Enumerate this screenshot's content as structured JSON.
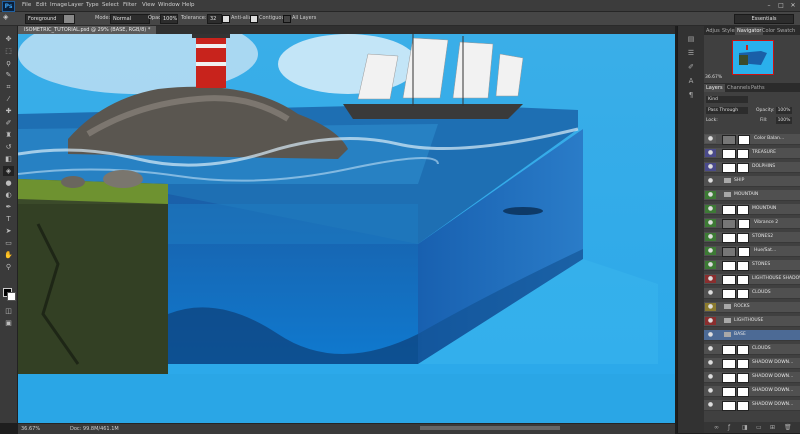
{
  "app": {
    "logo": "Ps"
  },
  "menu": [
    "File",
    "Edit",
    "Image",
    "Layer",
    "Type",
    "Select",
    "Filter",
    "View",
    "Window",
    "Help"
  ],
  "window_controls": [
    "–",
    "□",
    "✕"
  ],
  "options_bar": {
    "preset": "Foreground",
    "mode_label": "Mode:",
    "mode_value": "Normal",
    "opacity_label": "Opacity:",
    "opacity_value": "100%",
    "tolerance_label": "Tolerance:",
    "tolerance_value": "32",
    "antialias_label": "Anti-alias",
    "contiguous_label": "Contiguous",
    "alllayers_label": "All Layers",
    "workspace": "Essentials"
  },
  "document_tab": "ISOMETRIC_TUTORIAL.psd @ 29% (BASE, RGB/8) *",
  "status": {
    "zoom": "36.67%",
    "doc": "Doc: 99.8M/461.1M"
  },
  "panels": {
    "top_tabs": [
      "Adjus",
      "Styles",
      "Navigator",
      "Color",
      "Swatch"
    ],
    "nav_zoom": "36.67%",
    "layer_tabs": [
      "Layers",
      "Channels",
      "Paths"
    ],
    "kind_label": "Kind",
    "blend": "Pass Through",
    "opacity_label": "Opacity:",
    "opacity_value": "100%",
    "lock_label": "Lock:",
    "fill_label": "Fill:",
    "fill_value": "100%"
  },
  "layers": [
    {
      "name": "Color Balan...",
      "color": "#5a5a5a",
      "type": "adjust"
    },
    {
      "name": "TREASURE",
      "color": "#4a4a8a",
      "type": "layer"
    },
    {
      "name": "DOLPHINS",
      "color": "#4a4a8a",
      "type": "layer"
    },
    {
      "name": "SHIP",
      "color": "#505050",
      "type": "folder"
    },
    {
      "name": "MOUNTAIN",
      "color": "#3d7a35",
      "type": "folder"
    },
    {
      "name": "MOUNTAIN",
      "color": "#3d7a35",
      "type": "layer"
    },
    {
      "name": "Vibrance 2",
      "color": "#3d7a35",
      "type": "adjust"
    },
    {
      "name": "STONES2",
      "color": "#3d7a35",
      "type": "layer"
    },
    {
      "name": "Hue/Sat...",
      "color": "#3d7a35",
      "type": "adjust"
    },
    {
      "name": "STONES",
      "color": "#3d7a35",
      "type": "layer"
    },
    {
      "name": "LIGHTHOUSE SHADOW",
      "color": "#8a2e2e",
      "type": "layer"
    },
    {
      "name": "CLOUDS",
      "color": "#505050",
      "type": "layer"
    },
    {
      "name": "ROCKS",
      "color": "#8a7a2e",
      "type": "folder"
    },
    {
      "name": "LIGHTHOUSE",
      "color": "#8a2e2e",
      "type": "folder"
    },
    {
      "name": "BASE",
      "color": "#4c6a95",
      "type": "folder",
      "selected": true
    },
    {
      "name": "CLOUDS",
      "color": "#505050",
      "type": "layer"
    },
    {
      "name": "SHADOW DOWN...",
      "color": "#505050",
      "type": "layer"
    },
    {
      "name": "SHADOW DOWN...",
      "color": "#505050",
      "type": "layer"
    },
    {
      "name": "SHADOW DOWN...",
      "color": "#505050",
      "type": "layer"
    },
    {
      "name": "SHADOW DOWN...",
      "color": "#505050",
      "type": "layer"
    }
  ]
}
